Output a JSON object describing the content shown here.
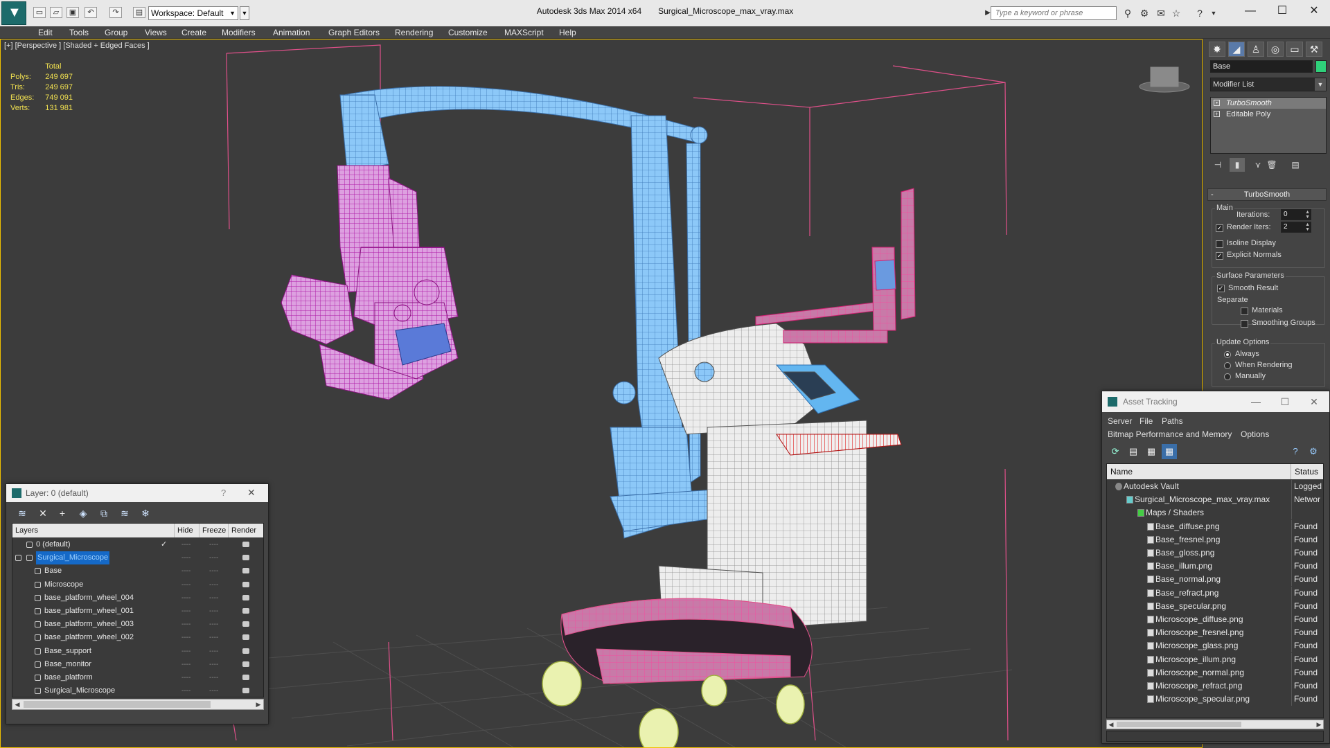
{
  "titlebar": {
    "workspace": "Workspace: Default",
    "app_name": "Autodesk 3ds Max  2014 x64",
    "file_name": "Surgical_Microscope_max_vray.max",
    "search_placeholder": "Type a keyword or phrase",
    "minimize": "—",
    "maximize": "☐",
    "close": "✕"
  },
  "menu": [
    "Edit",
    "Tools",
    "Group",
    "Views",
    "Create",
    "Modifiers",
    "Animation",
    "Graph Editors",
    "Rendering",
    "Customize",
    "MAXScript",
    "Help"
  ],
  "viewport": {
    "label": "[+] [Perspective ] [Shaded + Edged Faces ]",
    "stats": {
      "header": "Total",
      "rows": [
        {
          "label": "Polys:",
          "value": "249 697"
        },
        {
          "label": "Tris:",
          "value": "249 697"
        },
        {
          "label": "Edges:",
          "value": "749 091"
        },
        {
          "label": "Verts:",
          "value": "131 981"
        }
      ]
    }
  },
  "command_panel": {
    "object_name": "Base",
    "object_color": "#2fd07a",
    "modifier_list": "Modifier List",
    "stack": [
      {
        "label": "TurboSmooth",
        "selected": true
      },
      {
        "label": "Editable Poly",
        "selected": false
      }
    ],
    "rollout_title": "TurboSmooth",
    "main": {
      "title": "Main",
      "iterations_label": "Iterations:",
      "iterations_value": "0",
      "render_iters_label": "Render Iters:",
      "render_iters_value": "2",
      "isoline_display": "Isoline Display",
      "explicit_normals": "Explicit Normals"
    },
    "surface": {
      "title": "Surface Parameters",
      "smooth_result": "Smooth Result",
      "separate": "Separate",
      "materials": "Materials",
      "smoothing_groups": "Smoothing Groups"
    },
    "update": {
      "title": "Update Options",
      "always": "Always",
      "when_rendering": "When Rendering",
      "manually": "Manually"
    }
  },
  "layer_window": {
    "title": "Layer: 0 (default)",
    "help": "?",
    "close": "✕",
    "columns": [
      "Layers",
      "Hide",
      "Freeze",
      "Render"
    ],
    "rows": [
      {
        "name": "0 (default)",
        "level": 0,
        "checked": true,
        "selected": false
      },
      {
        "name": "Surgical_Microscope",
        "level": 0,
        "checked": false,
        "selected": true
      },
      {
        "name": "Base",
        "level": 1
      },
      {
        "name": "Microscope",
        "level": 1
      },
      {
        "name": "base_platform_wheel_004",
        "level": 1
      },
      {
        "name": "base_platform_wheel_001",
        "level": 1
      },
      {
        "name": "base_platform_wheel_003",
        "level": 1
      },
      {
        "name": "base_platform_wheel_002",
        "level": 1
      },
      {
        "name": "Base_support",
        "level": 1
      },
      {
        "name": "Base_monitor",
        "level": 1
      },
      {
        "name": "base_platform",
        "level": 1
      },
      {
        "name": "Surgical_Microscope",
        "level": 1
      }
    ],
    "dash": "----"
  },
  "asset_window": {
    "title": "Asset Tracking",
    "menu_row1": [
      "Server",
      "File",
      "Paths"
    ],
    "menu_row2": [
      "Bitmap Performance and Memory",
      "Options"
    ],
    "columns": [
      "Name",
      "Status"
    ],
    "rows": [
      {
        "name": "Autodesk Vault",
        "status": "Logged",
        "level": 0
      },
      {
        "name": "Surgical_Microscope_max_vray.max",
        "status": "Networ",
        "level": 1
      },
      {
        "name": "Maps / Shaders",
        "status": "",
        "level": 2
      },
      {
        "name": "Base_diffuse.png",
        "status": "Found",
        "level": 3
      },
      {
        "name": "Base_fresnel.png",
        "status": "Found",
        "level": 3
      },
      {
        "name": "Base_gloss.png",
        "status": "Found",
        "level": 3
      },
      {
        "name": "Base_illum.png",
        "status": "Found",
        "level": 3
      },
      {
        "name": "Base_normal.png",
        "status": "Found",
        "level": 3
      },
      {
        "name": "Base_refract.png",
        "status": "Found",
        "level": 3
      },
      {
        "name": "Base_specular.png",
        "status": "Found",
        "level": 3
      },
      {
        "name": "Microscope_diffuse.png",
        "status": "Found",
        "level": 3
      },
      {
        "name": "Microscope_fresnel.png",
        "status": "Found",
        "level": 3
      },
      {
        "name": "Microscope_glass.png",
        "status": "Found",
        "level": 3
      },
      {
        "name": "Microscope_illum.png",
        "status": "Found",
        "level": 3
      },
      {
        "name": "Microscope_normal.png",
        "status": "Found",
        "level": 3
      },
      {
        "name": "Microscope_refract.png",
        "status": "Found",
        "level": 3
      },
      {
        "name": "Microscope_specular.png",
        "status": "Found",
        "level": 3
      }
    ]
  },
  "colors": {
    "arm_blue": "#6fb4f0",
    "body_white": "#e8e8e8",
    "head_magenta": "#d040c0",
    "wheel_yellow": "#e8f0a0",
    "bbox_pink": "#e0508a",
    "viewport_border": "#f0c000"
  }
}
